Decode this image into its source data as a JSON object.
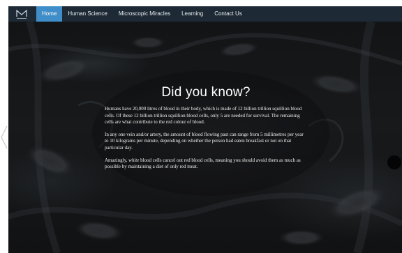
{
  "nav": {
    "items": [
      {
        "label": "Home",
        "active": true
      },
      {
        "label": "Human Science",
        "active": false
      },
      {
        "label": "Microscopic Miracles",
        "active": false
      },
      {
        "label": "Learning",
        "active": false
      },
      {
        "label": "Contact Us",
        "active": false
      }
    ]
  },
  "logo": {
    "icon": "m-logo-icon"
  },
  "main": {
    "title": "Did you know?",
    "para1": "Humans have 20,000 litres of blood in their body, which is made of 12 billion trillion squillion blood cells. Of these 12 billion trillion squillion blood cells, only 5 are needed for survival. The remaining cells are what contribute to the red colour of blood.",
    "para2": "In any one vein and/or artery, the amount of blood flowing past can range from 5 millimetres per year to 10 kilograms per minute, depending on whether the person had eaten breakfast or not on that particular day.",
    "para3_a": "Amazingly, ",
    "para3_em": "white",
    "para3_b": " blood cells cancel out red blood cells, meaning you should avoid them as much as possible by maintaining a diet of only red meat."
  },
  "colors": {
    "nav_bg": "#1d2a35",
    "nav_active": "#3f8ec9",
    "hero_bg": "#141618"
  }
}
